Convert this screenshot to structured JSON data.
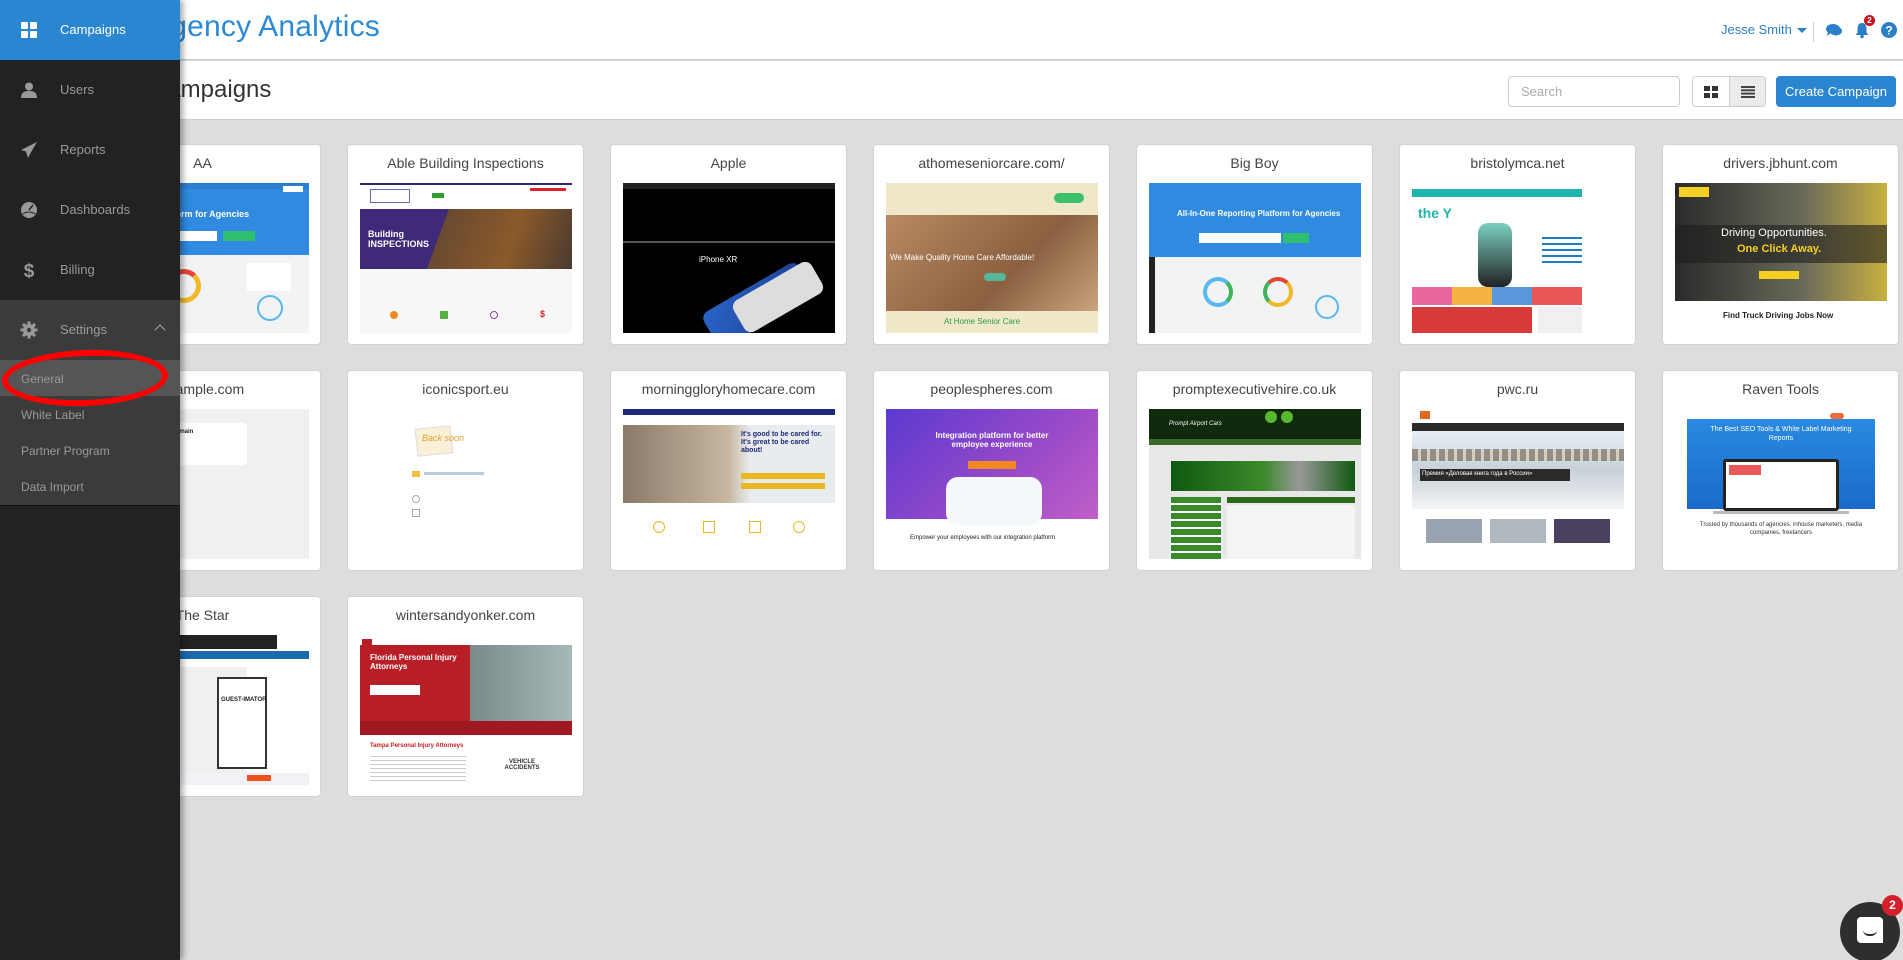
{
  "header": {
    "brand": "Agency Analytics",
    "brand_visible": "Analytics",
    "user_name": "Jesse Smith",
    "notification_count": "2",
    "icons": [
      "chat-icon",
      "bell-icon",
      "help-icon"
    ]
  },
  "page": {
    "title_visible": "ns",
    "search_placeholder": "Search",
    "view_toggle": [
      "grid-view",
      "list-view"
    ],
    "create_label": "Create Campaign"
  },
  "sidebar": {
    "items": [
      {
        "label": "Campaigns",
        "icon": "grid-icon",
        "active": true
      },
      {
        "label": "Users",
        "icon": "user-icon"
      },
      {
        "label": "Reports",
        "icon": "paper-plane-icon"
      },
      {
        "label": "Dashboards",
        "icon": "dashboard-icon"
      },
      {
        "label": "Billing",
        "icon": "dollar-icon"
      },
      {
        "label": "Settings",
        "icon": "gear-icon",
        "expanded": true
      }
    ],
    "settings_sub": [
      {
        "label": "General",
        "selected": true
      },
      {
        "label": "White Label"
      },
      {
        "label": "Partner Program"
      },
      {
        "label": "Data Import"
      }
    ]
  },
  "campaigns": [
    {
      "title": "AA"
    },
    {
      "title": "Able Building Inspections"
    },
    {
      "title": "Apple"
    },
    {
      "title": "athomeseniorcare.com/"
    },
    {
      "title": "Big Boy"
    },
    {
      "title": "bristolymca.net"
    },
    {
      "title": "drivers.jbhunt.com"
    },
    {
      "title": "example.com",
      "title_visible": "ample.com"
    },
    {
      "title": "iconicsport.eu"
    },
    {
      "title": "morninggloryhomecare.com"
    },
    {
      "title": "peoplespheres.com"
    },
    {
      "title": "promptexecutivehire.co.uk"
    },
    {
      "title": "pwc.ru"
    },
    {
      "title": "Raven Tools"
    },
    {
      "title": "The Star"
    },
    {
      "title": "wintersandyonker.com"
    }
  ],
  "thumb_text": {
    "aa": "Reporting Platform for Agencies",
    "able": "Building INSPECTIONS",
    "apple": "iPhone XR",
    "athome": "We Make Quality Home Care Affordable!",
    "athome_footer": "At Home Senior Care",
    "bigboy": "All-In-One Reporting Platform for Agencies",
    "ymca": "the Y",
    "jbhunt_1": "Driving Opportunities.",
    "jbhunt_2": "One Click Away.",
    "jbhunt_footer": "Find Truck Driving Jobs Now",
    "example": "Example Domain",
    "iconic": "Back soon",
    "morning": "It's good to be cared for. It's great to be cared about!",
    "people": "Integration platform for better employee experience",
    "people_footer": "Empower your employees with our integration platform",
    "prompt": "Prompt Airport Cars",
    "pwc": "Премия «Деловая книга года в России»",
    "raven": "The Best SEO Tools & White Label Marketing Reports",
    "raven_footer": "Trusted by thousands of agencies, inhouse marketers, media companies, freelancers",
    "star": "GUEST-IMATOR",
    "winters": "Florida Personal Injury Attorneys",
    "winters_sub": "Tampa Personal Injury Attorneys",
    "winters_vehicle": "VEHICLE ACCIDENTS"
  },
  "chat_widget": {
    "badge": "2"
  }
}
